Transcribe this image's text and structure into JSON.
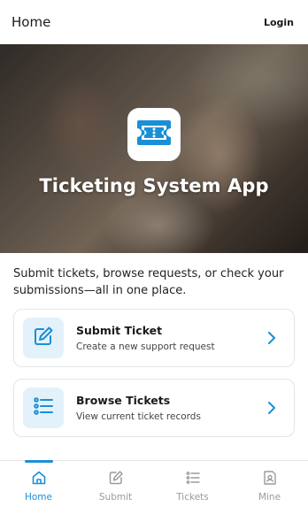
{
  "header": {
    "title": "Home",
    "login_label": "Login"
  },
  "hero": {
    "app_name": "Ticketing System App",
    "icon": "ticket-icon"
  },
  "intro_text": "Submit tickets, browse requests, or check your submissions—all in one place.",
  "cards": [
    {
      "title": "Submit Ticket",
      "subtitle": "Create a new support request",
      "icon": "edit-icon"
    },
    {
      "title": "Browse Tickets",
      "subtitle": "View current ticket records",
      "icon": "list-icon"
    }
  ],
  "tabs": [
    {
      "label": "Home",
      "icon": "home-icon",
      "active": true
    },
    {
      "label": "Submit",
      "icon": "edit-icon",
      "active": false
    },
    {
      "label": "Tickets",
      "icon": "list-icon",
      "active": false
    },
    {
      "label": "Mine",
      "icon": "profile-card-icon",
      "active": false
    }
  ],
  "colors": {
    "accent": "#1a8fd6",
    "card_icon_bg": "#e3f1fb",
    "inactive": "#9a9a9a"
  }
}
